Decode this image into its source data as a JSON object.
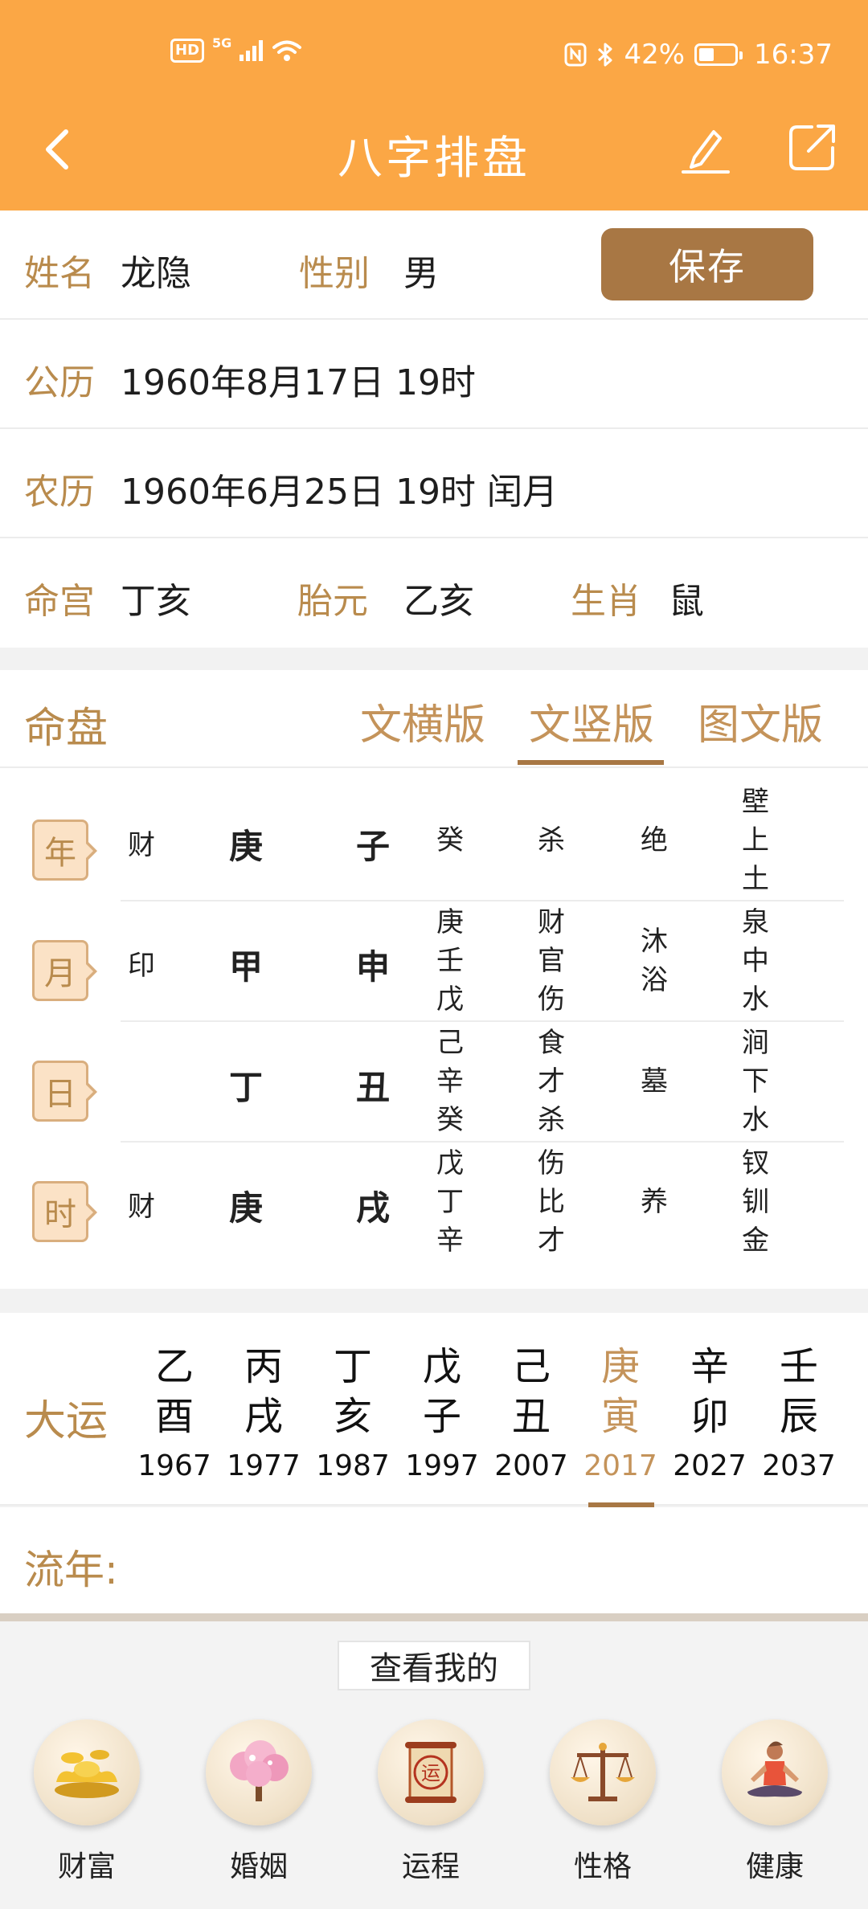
{
  "status_bar": {
    "network": "5G",
    "hd": "HD",
    "battery": "42%",
    "battery_level": 0.42,
    "time": "16:37"
  },
  "header": {
    "title": "八字排盘",
    "bg_color": "#fba745"
  },
  "info": {
    "name_label": "姓名",
    "name_value": "龙隐",
    "gender_label": "性别",
    "gender_value": "男",
    "save_label": "保存",
    "solar_label": "公历",
    "solar_value": "1960年8月17日 19时",
    "lunar_label": "农历",
    "lunar_value": "1960年6月25日 19时 闰月",
    "minggong_label": "命宫",
    "minggong_value": "丁亥",
    "taiyuan_label": "胎元",
    "taiyuan_value": "乙亥",
    "shengxiao_label": "生肖",
    "shengxiao_value": "鼠"
  },
  "chart": {
    "title": "命盘",
    "tabs": [
      "文横版",
      "文竖版",
      "图文版"
    ],
    "active_tab": "文竖版",
    "pillars": [
      {
        "label": "年",
        "shishen": "财",
        "stem": "庚",
        "branch": "子",
        "hidden": [
          "癸"
        ],
        "hidden_shishen": [
          "杀"
        ],
        "state": [
          "绝"
        ],
        "nayin": [
          "壁",
          "上",
          "土"
        ]
      },
      {
        "label": "月",
        "shishen": "印",
        "stem": "甲",
        "branch": "申",
        "hidden": [
          "庚",
          "壬",
          "戊"
        ],
        "hidden_shishen": [
          "财",
          "官",
          "伤"
        ],
        "state": [
          "沐",
          "浴"
        ],
        "nayin": [
          "泉",
          "中",
          "水"
        ]
      },
      {
        "label": "日",
        "shishen": "",
        "stem": "丁",
        "branch": "丑",
        "hidden": [
          "己",
          "辛",
          "癸"
        ],
        "hidden_shishen": [
          "食",
          "才",
          "杀"
        ],
        "state": [
          "墓"
        ],
        "nayin": [
          "涧",
          "下",
          "水"
        ]
      },
      {
        "label": "时",
        "shishen": "财",
        "stem": "庚",
        "branch": "戌",
        "hidden": [
          "戊",
          "丁",
          "辛"
        ],
        "hidden_shishen": [
          "伤",
          "比",
          "才"
        ],
        "state": [
          "养"
        ],
        "nayin": [
          "钗",
          "钏",
          "金"
        ]
      }
    ]
  },
  "dayun": {
    "label": "大运",
    "items": [
      {
        "gan": "乙",
        "zhi": "酉",
        "year": "1967"
      },
      {
        "gan": "丙",
        "zhi": "戌",
        "year": "1977"
      },
      {
        "gan": "丁",
        "zhi": "亥",
        "year": "1987"
      },
      {
        "gan": "戊",
        "zhi": "子",
        "year": "1997"
      },
      {
        "gan": "己",
        "zhi": "丑",
        "year": "2007"
      },
      {
        "gan": "庚",
        "zhi": "寅",
        "year": "2017"
      },
      {
        "gan": "辛",
        "zhi": "卯",
        "year": "2027"
      },
      {
        "gan": "壬",
        "zhi": "辰",
        "year": "2037"
      }
    ],
    "active_index": 5
  },
  "liunian": {
    "label": "流年:"
  },
  "bottom": {
    "view_mine_label": "查看我的",
    "features": [
      {
        "label": "财富",
        "icon": "gold-ingot-icon"
      },
      {
        "label": "婚姻",
        "icon": "blossom-tree-icon"
      },
      {
        "label": "运程",
        "icon": "fortune-scroll-icon",
        "icon_text": "运"
      },
      {
        "label": "性格",
        "icon": "balance-scale-icon"
      },
      {
        "label": "健康",
        "icon": "meditation-icon"
      }
    ]
  }
}
